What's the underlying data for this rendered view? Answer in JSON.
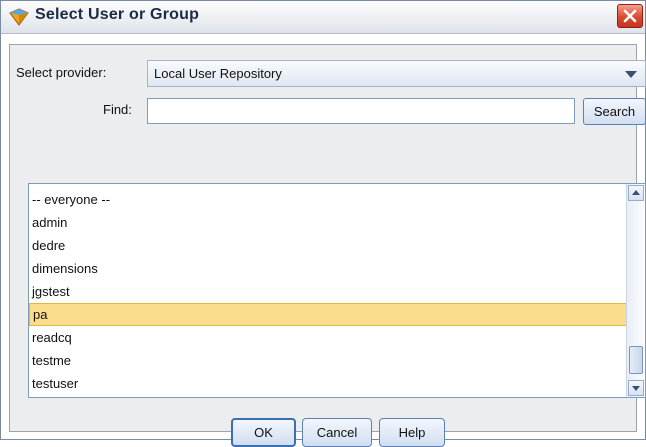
{
  "window": {
    "title": "Select User or Group"
  },
  "provider": {
    "label": "Select provider:",
    "value": "Local User Repository"
  },
  "find": {
    "label": "Find:",
    "value": "",
    "button": "Search"
  },
  "list": {
    "items": [
      "-- everyone --",
      "admin",
      "dedre",
      "dimensions",
      "jgstest",
      "pa",
      "readcq",
      "testme",
      "testuser"
    ],
    "selected": "pa"
  },
  "buttons": {
    "ok": "OK",
    "cancel": "Cancel",
    "help": "Help"
  },
  "colors": {
    "selection": "#fadd8c",
    "close": "#d94a2e",
    "accent": "#3a6fb5"
  },
  "icons": {
    "app": "app-logo-icon",
    "close": "close-icon"
  }
}
